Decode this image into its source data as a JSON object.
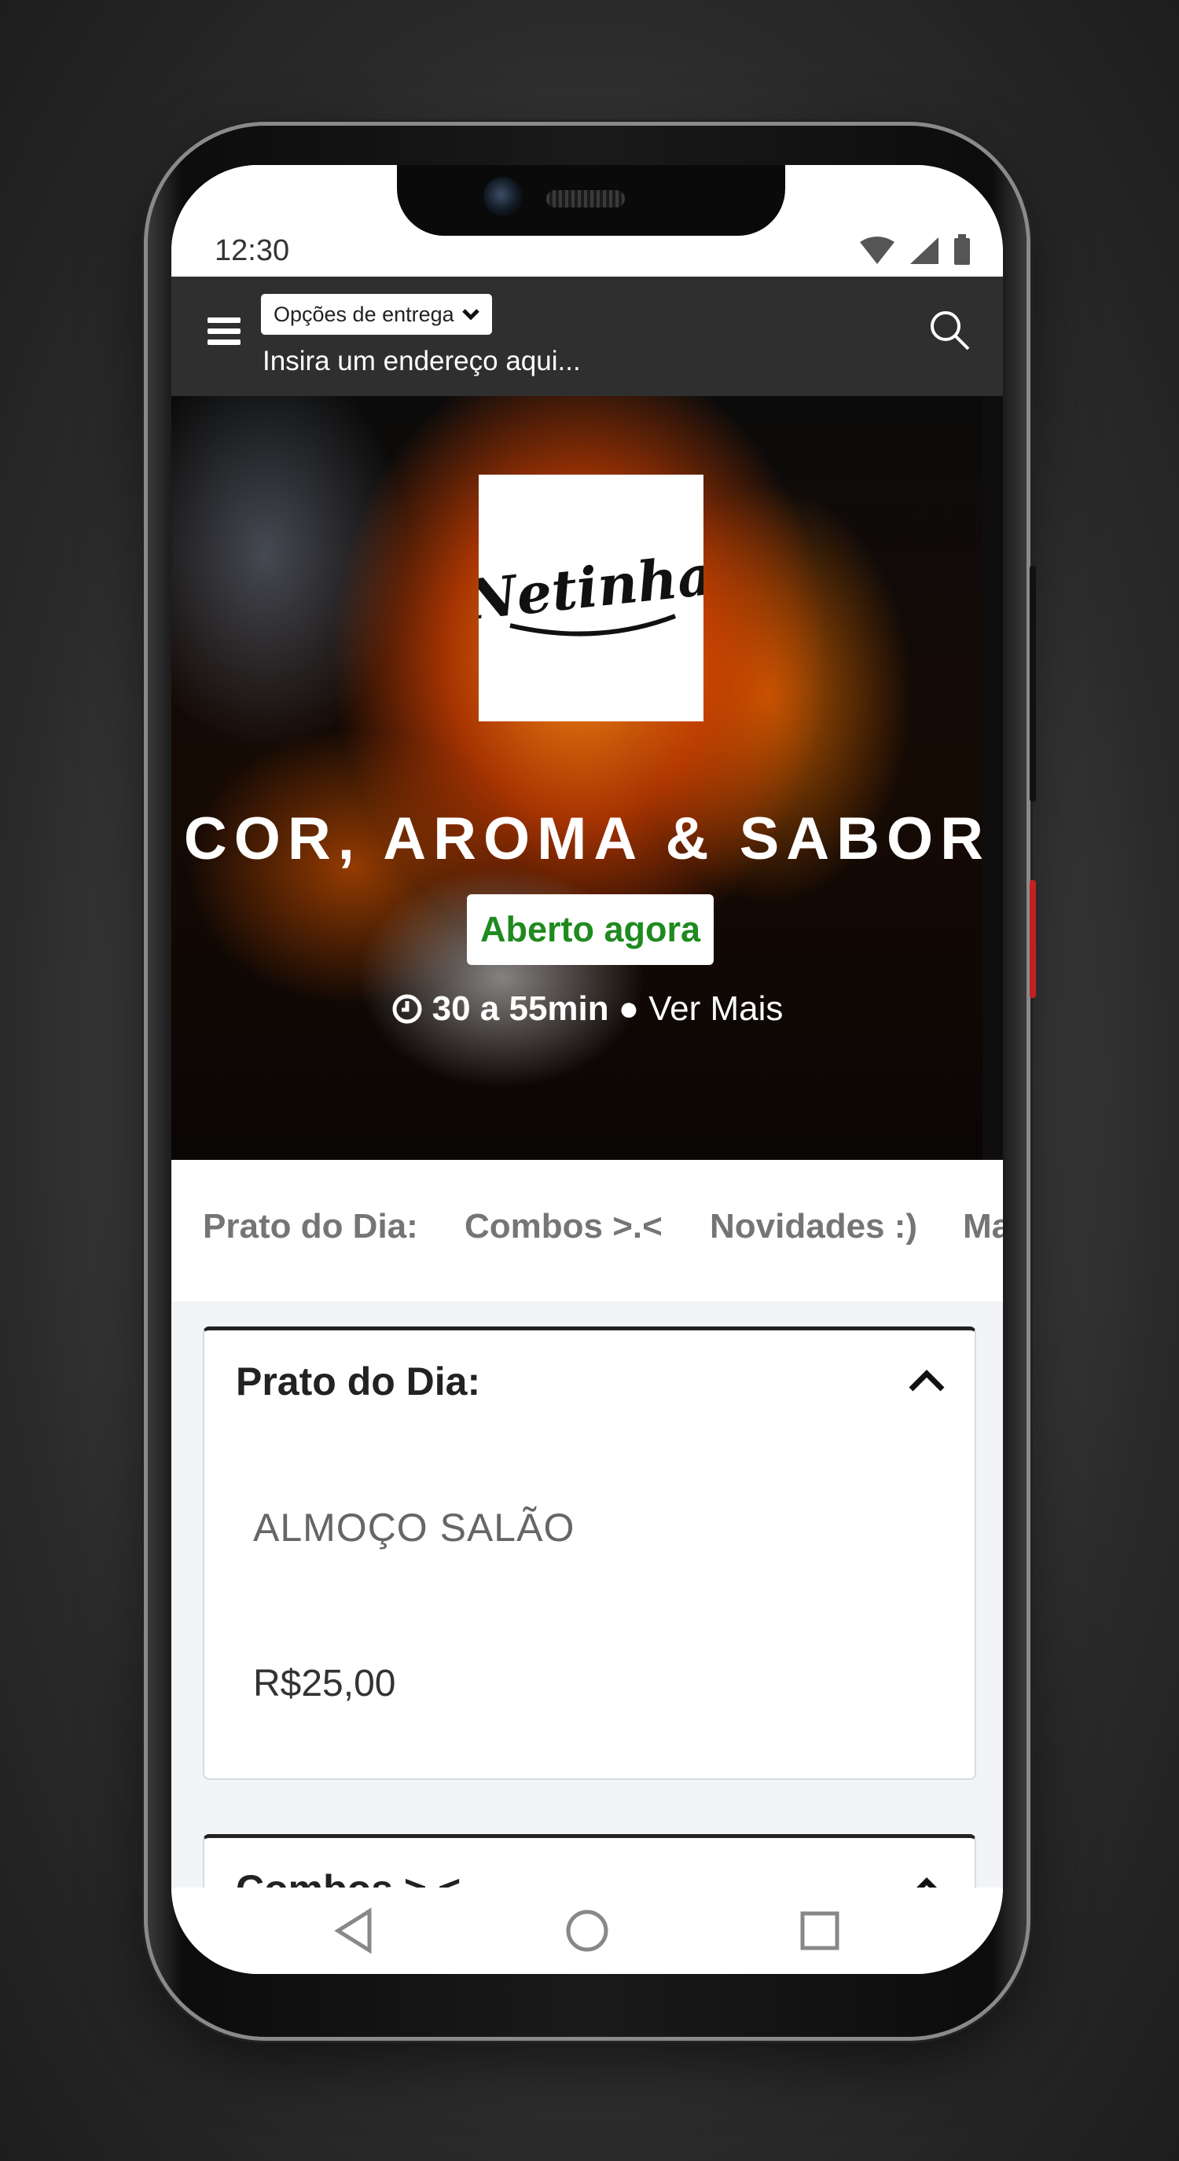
{
  "status_bar": {
    "time": "12:30"
  },
  "header": {
    "delivery_options": "Opções de entrega",
    "address_placeholder": "Insira um endereço aqui..."
  },
  "hero": {
    "logo_text": "Netinha",
    "title": "COR, AROMA & SABOR",
    "status_badge": "Aberto agora",
    "delivery_time": "30 a 55min",
    "separator": "●",
    "see_more": "Ver Mais"
  },
  "tabs": [
    "Prato do Dia:",
    "Combos >.<",
    "Novidades :)",
    "Ma"
  ],
  "sections": [
    {
      "title": "Prato do Dia:",
      "item_name": "ALMOÇO SALÃO",
      "item_price": "R$25,00"
    },
    {
      "title": "Combos >.<"
    }
  ],
  "colors": {
    "header_bg": "#2f2f2f",
    "open_green": "#1f8a1f",
    "tab_text": "#757575",
    "content_bg": "#f2f4f7"
  },
  "icons": [
    "menu-icon",
    "chevron-down-icon",
    "search-icon",
    "clock-icon",
    "chevron-up-icon",
    "back-icon",
    "home-icon",
    "recents-icon",
    "wifi-icon",
    "signal-icon",
    "battery-icon"
  ]
}
